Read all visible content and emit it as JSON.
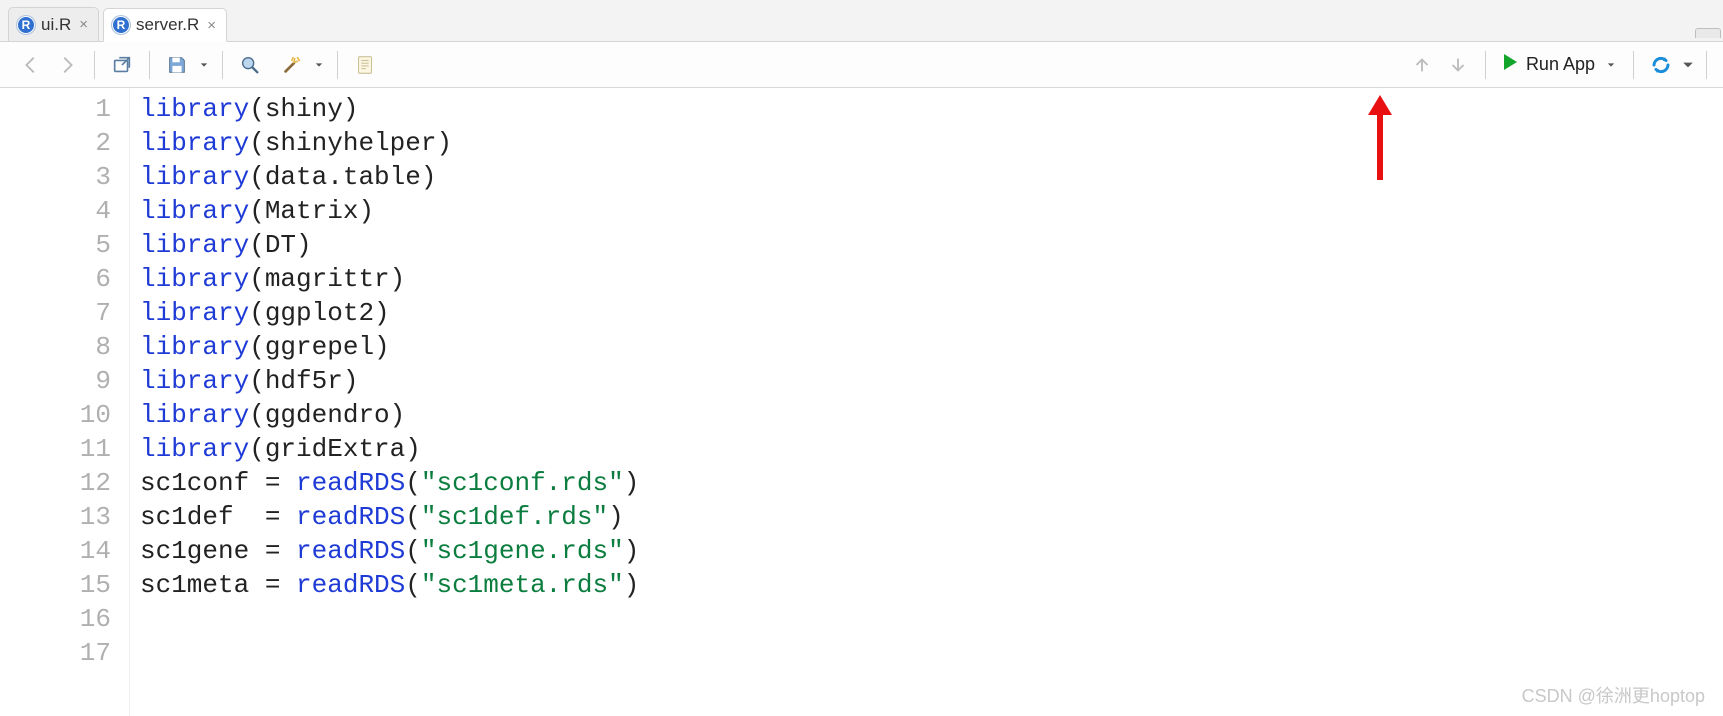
{
  "tabs": [
    {
      "label": "ui.R",
      "active": false
    },
    {
      "label": "server.R",
      "active": true
    }
  ],
  "toolbar": {
    "run_label": "Run App"
  },
  "code_lines": [
    [
      {
        "t": "fn",
        "v": "library"
      },
      {
        "t": "p",
        "v": "("
      },
      {
        "t": "p",
        "v": "shiny"
      },
      {
        "t": "p",
        "v": ")"
      }
    ],
    [
      {
        "t": "fn",
        "v": "library"
      },
      {
        "t": "p",
        "v": "("
      },
      {
        "t": "p",
        "v": "shinyhelper"
      },
      {
        "t": "p",
        "v": ")"
      }
    ],
    [
      {
        "t": "fn",
        "v": "library"
      },
      {
        "t": "p",
        "v": "("
      },
      {
        "t": "p",
        "v": "data.table"
      },
      {
        "t": "p",
        "v": ")"
      }
    ],
    [
      {
        "t": "fn",
        "v": "library"
      },
      {
        "t": "p",
        "v": "("
      },
      {
        "t": "p",
        "v": "Matrix"
      },
      {
        "t": "p",
        "v": ")"
      }
    ],
    [
      {
        "t": "fn",
        "v": "library"
      },
      {
        "t": "p",
        "v": "("
      },
      {
        "t": "p",
        "v": "DT"
      },
      {
        "t": "p",
        "v": ")"
      }
    ],
    [
      {
        "t": "fn",
        "v": "library"
      },
      {
        "t": "p",
        "v": "("
      },
      {
        "t": "p",
        "v": "magrittr"
      },
      {
        "t": "p",
        "v": ")"
      }
    ],
    [
      {
        "t": "fn",
        "v": "library"
      },
      {
        "t": "p",
        "v": "("
      },
      {
        "t": "p",
        "v": "ggplot2"
      },
      {
        "t": "p",
        "v": ")"
      }
    ],
    [
      {
        "t": "fn",
        "v": "library"
      },
      {
        "t": "p",
        "v": "("
      },
      {
        "t": "p",
        "v": "ggrepel"
      },
      {
        "t": "p",
        "v": ")"
      }
    ],
    [
      {
        "t": "fn",
        "v": "library"
      },
      {
        "t": "p",
        "v": "("
      },
      {
        "t": "p",
        "v": "hdf5r"
      },
      {
        "t": "p",
        "v": ")"
      }
    ],
    [
      {
        "t": "fn",
        "v": "library"
      },
      {
        "t": "p",
        "v": "("
      },
      {
        "t": "p",
        "v": "ggdendro"
      },
      {
        "t": "p",
        "v": ")"
      }
    ],
    [
      {
        "t": "fn",
        "v": "library"
      },
      {
        "t": "p",
        "v": "("
      },
      {
        "t": "p",
        "v": "gridExtra"
      },
      {
        "t": "p",
        "v": ")"
      }
    ],
    [
      {
        "t": "p",
        "v": "sc1conf = "
      },
      {
        "t": "fn",
        "v": "readRDS"
      },
      {
        "t": "p",
        "v": "("
      },
      {
        "t": "str",
        "v": "\"sc1conf.rds\""
      },
      {
        "t": "p",
        "v": ")"
      }
    ],
    [
      {
        "t": "p",
        "v": "sc1def  = "
      },
      {
        "t": "fn",
        "v": "readRDS"
      },
      {
        "t": "p",
        "v": "("
      },
      {
        "t": "str",
        "v": "\"sc1def.rds\""
      },
      {
        "t": "p",
        "v": ")"
      }
    ],
    [
      {
        "t": "p",
        "v": "sc1gene = "
      },
      {
        "t": "fn",
        "v": "readRDS"
      },
      {
        "t": "p",
        "v": "("
      },
      {
        "t": "str",
        "v": "\"sc1gene.rds\""
      },
      {
        "t": "p",
        "v": ")"
      }
    ],
    [
      {
        "t": "p",
        "v": "sc1meta = "
      },
      {
        "t": "fn",
        "v": "readRDS"
      },
      {
        "t": "p",
        "v": "("
      },
      {
        "t": "str",
        "v": "\"sc1meta.rds\""
      },
      {
        "t": "p",
        "v": ")"
      }
    ],
    [],
    []
  ],
  "watermark": "CSDN @徐洲更hoptop"
}
